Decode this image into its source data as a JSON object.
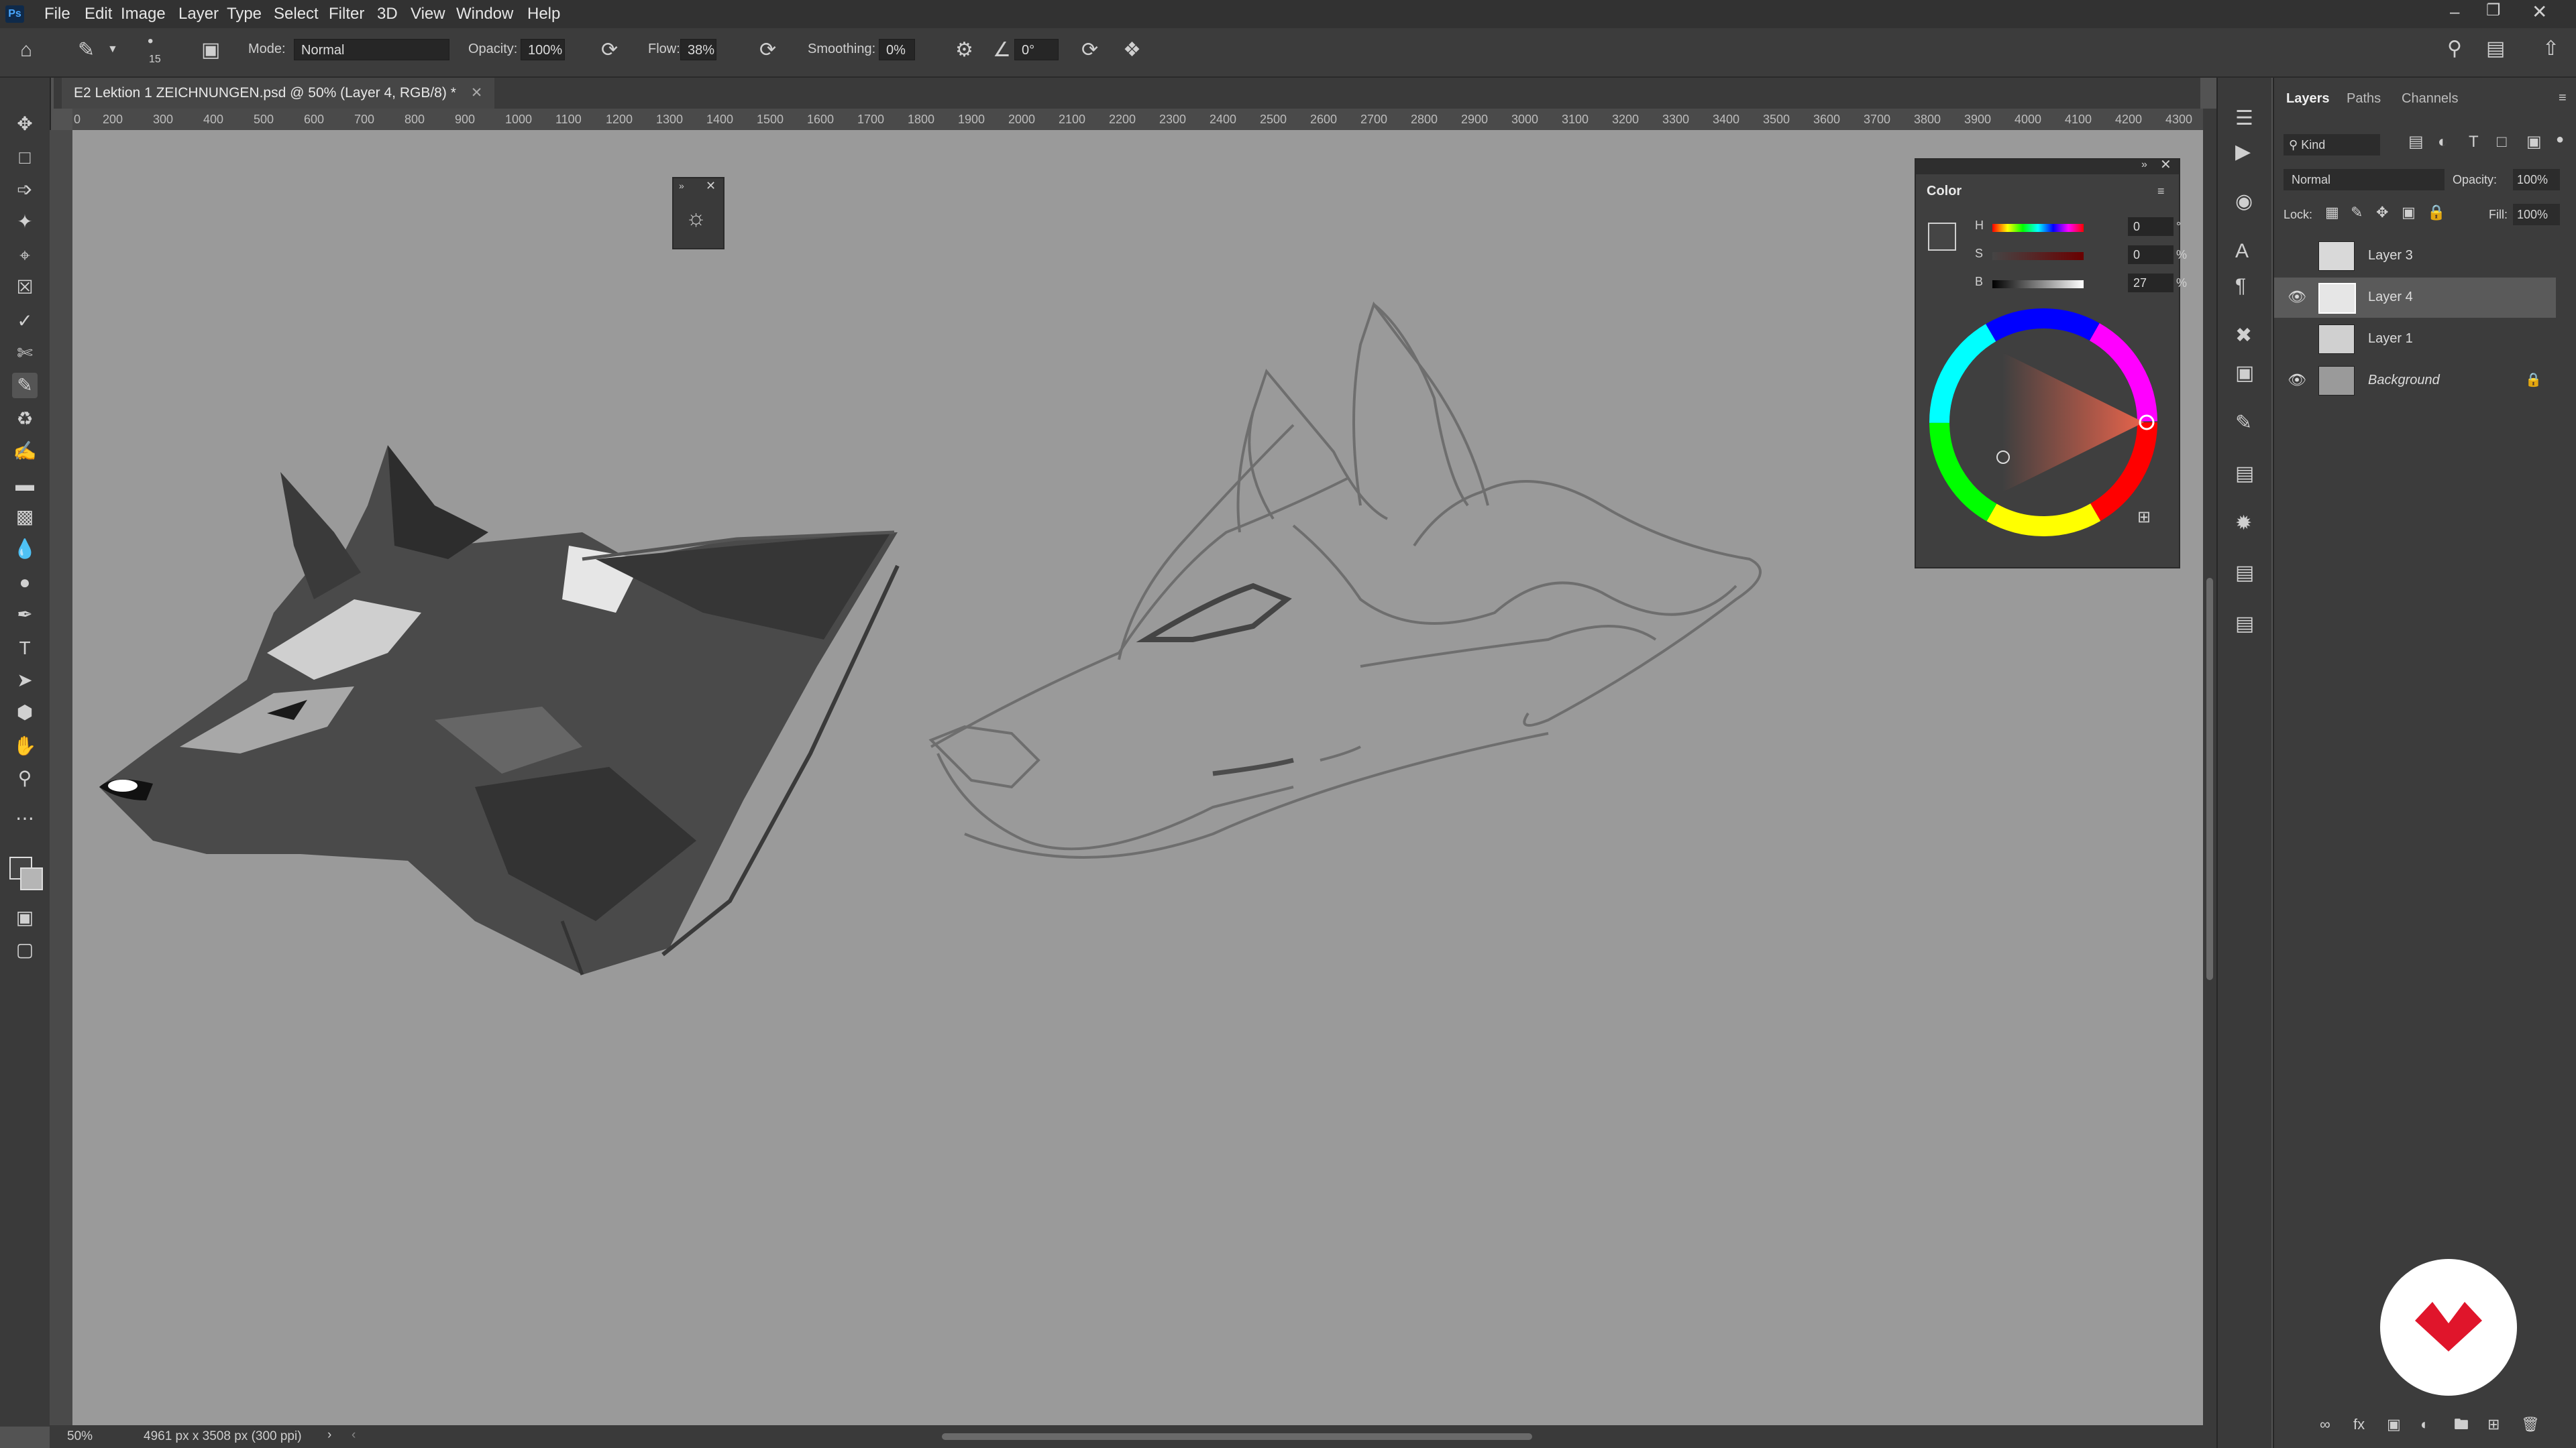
{
  "app": {
    "logo": "Ps",
    "menus": [
      "File",
      "Edit",
      "Image",
      "Layer",
      "Type",
      "Select",
      "Filter",
      "3D",
      "View",
      "Window",
      "Help"
    ]
  },
  "options_bar": {
    "brush_size": "15",
    "mode_label": "Mode:",
    "mode_value": "Normal",
    "opacity_label": "Opacity:",
    "opacity_value": "100%",
    "flow_label": "Flow:",
    "flow_value": "38%",
    "smoothing_label": "Smoothing:",
    "smoothing_value": "0%",
    "angle_value": "0°"
  },
  "document": {
    "tab_title": "E2 Lektion 1 ZEICHNUNGEN.psd @ 50% (Layer 4, RGB/8) *",
    "zoom": "50%",
    "doc_info": "4961 px x 3508 px (300 ppi)"
  },
  "ruler": {
    "top_ticks": [
      "0",
      "200",
      "300",
      "400",
      "500",
      "600",
      "700",
      "800",
      "900",
      "1000",
      "1100",
      "1200",
      "1300",
      "1400",
      "1500",
      "1600",
      "1700",
      "1800",
      "1900",
      "2000",
      "2100",
      "2200",
      "2300",
      "2400",
      "2500",
      "2600",
      "2700",
      "2800",
      "2900",
      "3000",
      "3100",
      "3200",
      "3300",
      "3400",
      "3500",
      "3600",
      "3700",
      "3800",
      "3900",
      "4000",
      "4100",
      "4200",
      "4300"
    ]
  },
  "color_panel": {
    "title": "Color",
    "h_label": "H",
    "h_value": "0",
    "h_unit": "°",
    "s_label": "S",
    "s_value": "0",
    "s_unit": "%",
    "b_label": "B",
    "b_value": "27",
    "b_unit": "%"
  },
  "layers_panel": {
    "tabs": [
      "Layers",
      "Paths",
      "Channels"
    ],
    "kind_label": "Kind",
    "blend_mode": "Normal",
    "opacity_label": "Opacity:",
    "opacity_value": "100%",
    "lock_label": "Lock:",
    "fill_label": "Fill:",
    "fill_value": "100%",
    "layers": [
      {
        "name": "Layer 3",
        "visible": false,
        "selected": false
      },
      {
        "name": "Layer 4",
        "visible": true,
        "selected": true
      },
      {
        "name": "Layer 1",
        "visible": false,
        "selected": false
      },
      {
        "name": "Background",
        "visible": true,
        "selected": false,
        "locked": true
      }
    ]
  },
  "colors": {
    "canvas": "#9a9a9a",
    "panel_bg": "#3c3c3c",
    "behance_red": "#e0152b"
  }
}
